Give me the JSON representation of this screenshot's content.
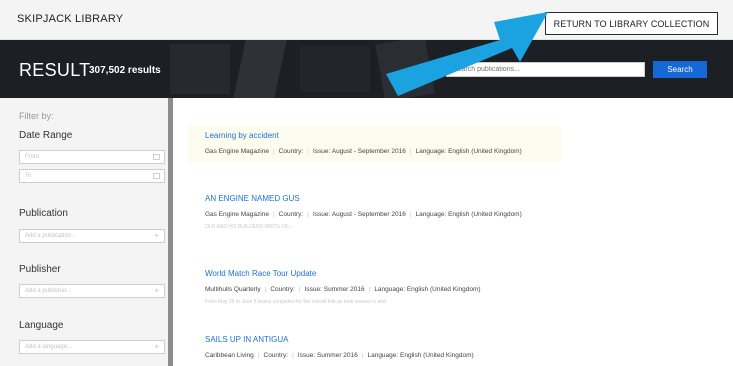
{
  "header": {
    "brand": "SKIPJACK LIBRARY",
    "return_label": "RETURN TO LIBRARY COLLECTION"
  },
  "hero": {
    "title": "RESULT",
    "count": "307,502 results",
    "search_placeholder": "Search publications...",
    "search_label": "Search"
  },
  "sidebar": {
    "filter_by": "Filter by:",
    "date_range": {
      "title": "Date Range",
      "from_placeholder": "From",
      "to_placeholder": "To"
    },
    "publication": {
      "title": "Publication",
      "placeholder": "Add a publication..."
    },
    "publisher": {
      "title": "Publisher",
      "placeholder": "Add a publisher..."
    },
    "language": {
      "title": "Language",
      "placeholder": "Add a language..."
    }
  },
  "results": [
    {
      "title": "Learning by accident",
      "publication": "Gas Engine Magazine",
      "country": "Country:",
      "issue": "Issue: August - September 2016",
      "language": "Language: English (United Kingdom)",
      "snippet": "",
      "highlighted": true
    },
    {
      "title": "AN ENGINE NAMED GUS",
      "publication": "Gas Engine Magazine",
      "country": "Country:",
      "issue": "Issue: August - September 2016",
      "language": "Language: English (United Kingdom)",
      "snippet": "OLD AND HIS BUILDERS WRITE OF...",
      "highlighted": false
    },
    {
      "title": "World Match Race Tour Update",
      "publication": "Multihulls Quarterly",
      "country": "Country:",
      "issue": "Issue: Summer 2016",
      "language": "Language: English (United Kingdom)",
      "snippet": "From May 26 to June 5 teams competed for the overall title as tone season in and",
      "highlighted": false
    },
    {
      "title": "SAILS UP IN ANTIGUA",
      "publication": "Caribbean Living",
      "country": "Country:",
      "issue": "Issue: Summer 2016",
      "language": "Language: English (United Kingdom)",
      "snippet": "",
      "highlighted": false
    }
  ],
  "colors": {
    "accent": "#1668d6",
    "arrow": "#1aa3e0",
    "hero_bg": "#1c1f24",
    "link": "#1f72d1"
  }
}
